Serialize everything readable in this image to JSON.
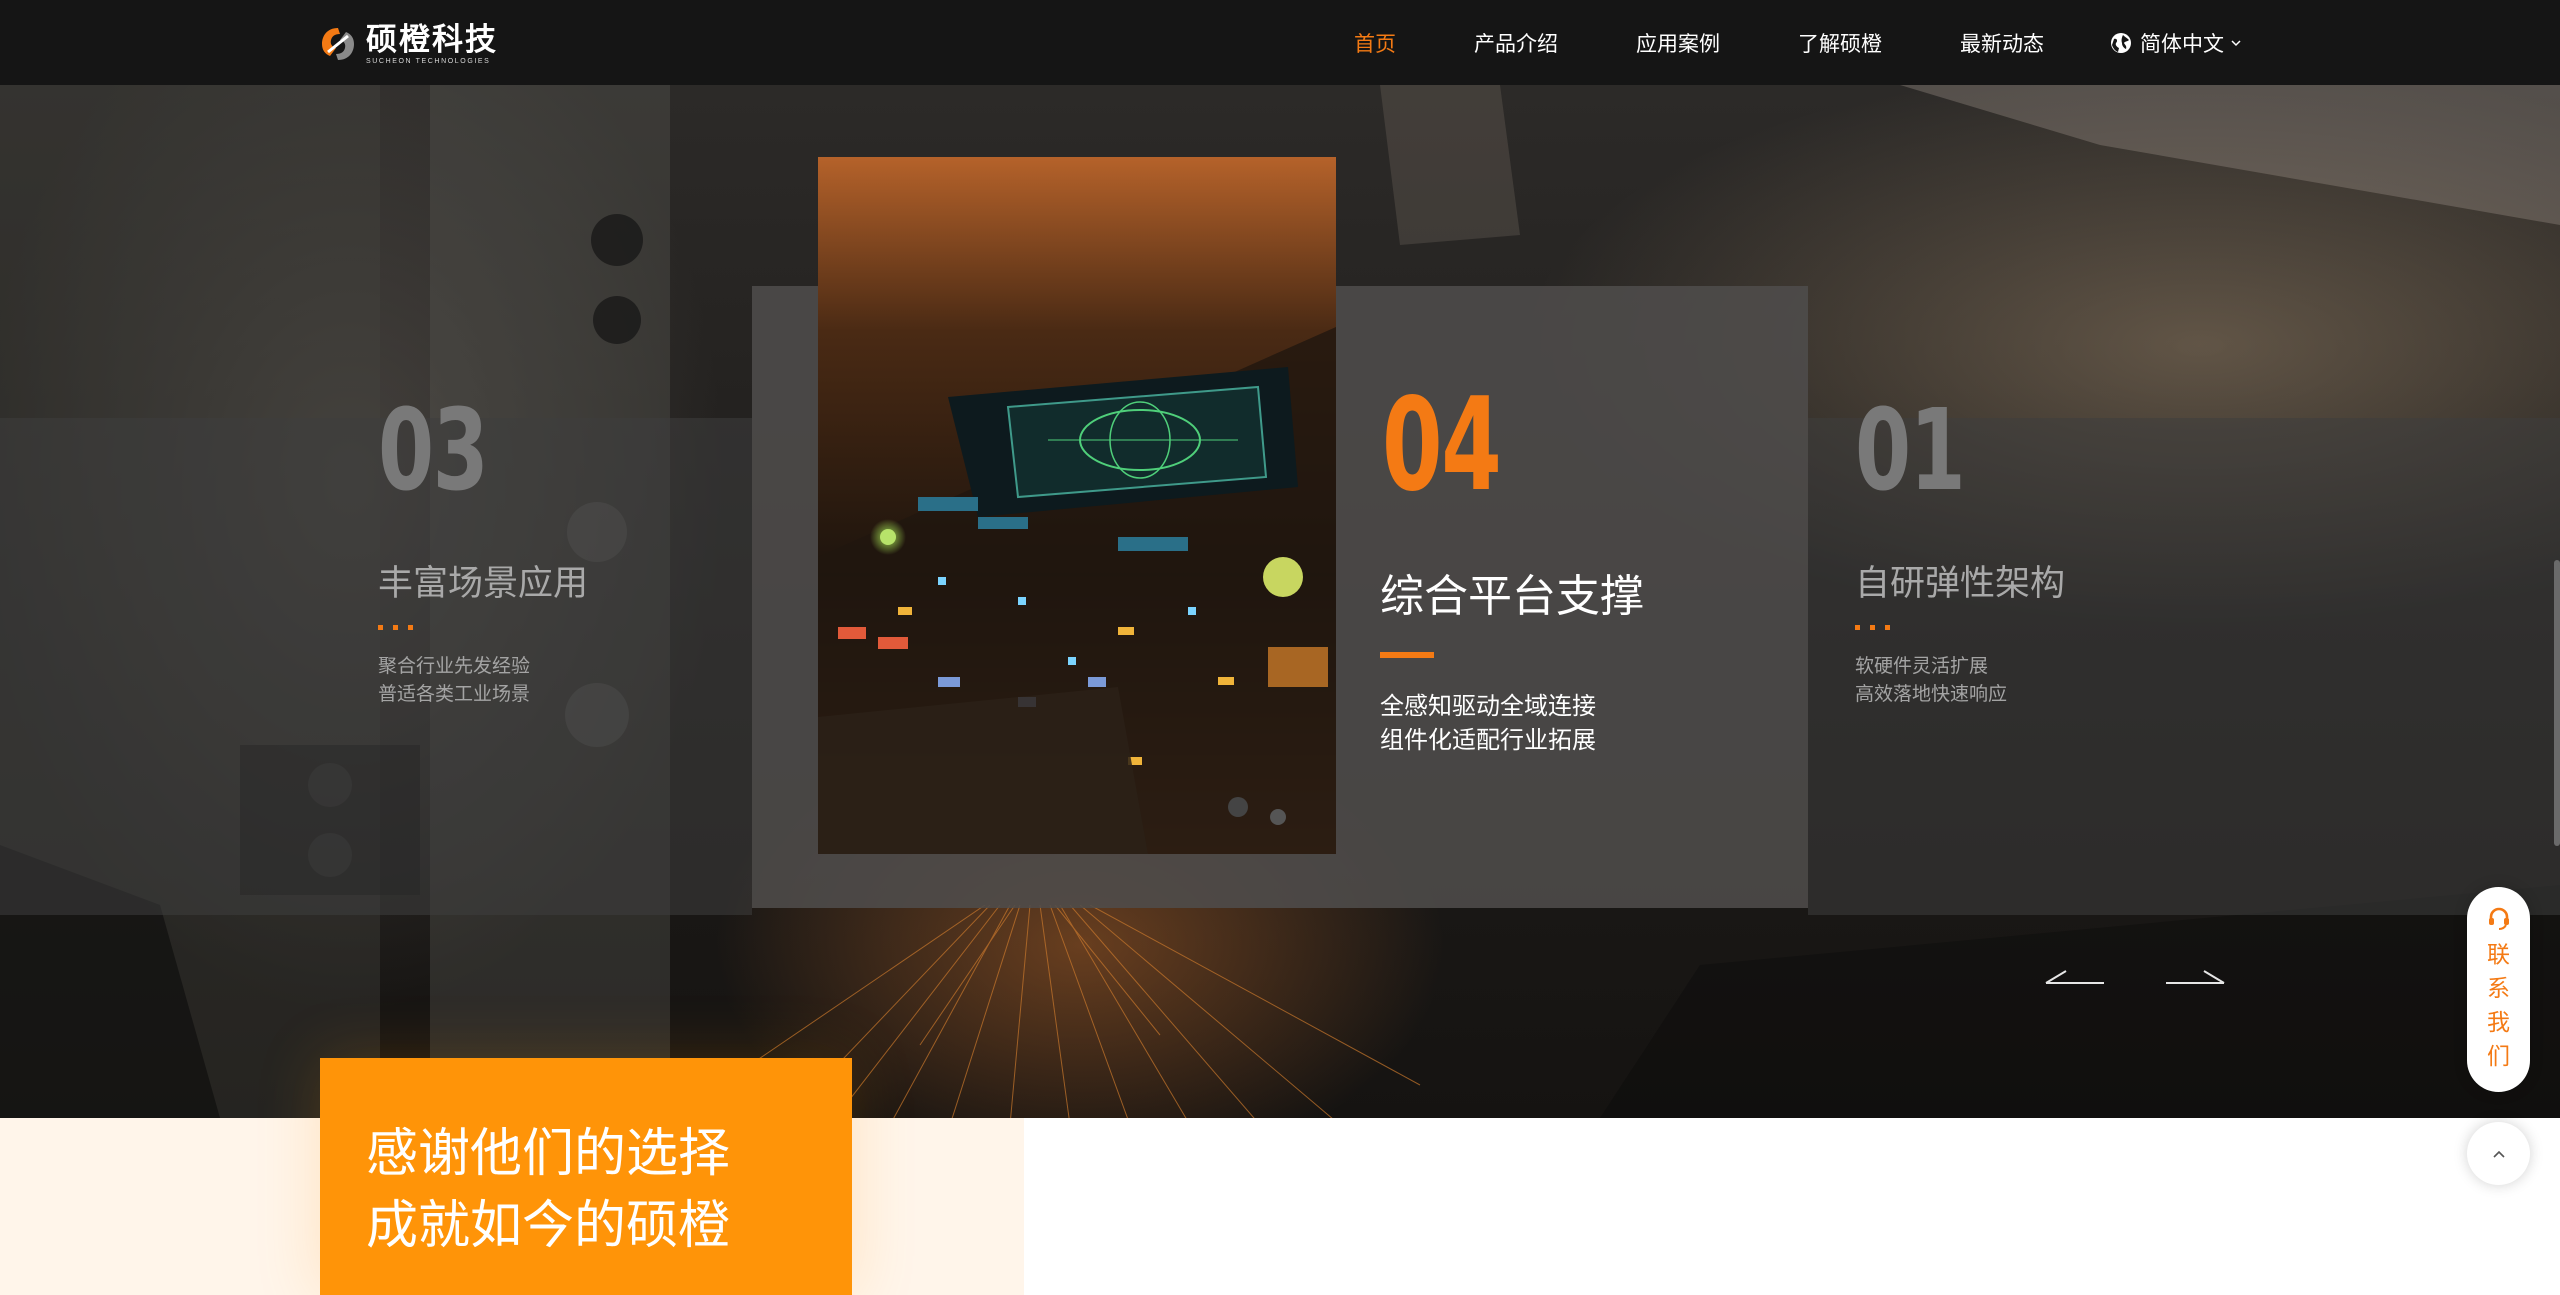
{
  "brand": {
    "name": "硕橙科技",
    "tagline": "SUCHEON TECHNOLOGIES"
  },
  "nav": {
    "items": [
      "首页",
      "产品介绍",
      "应用案例",
      "了解硕橙",
      "最新动态"
    ],
    "active_index": 0,
    "language": "简体中文"
  },
  "carousel": {
    "left": {
      "number": "03",
      "title": "丰富场景应用",
      "desc": [
        "聚合行业先发经验",
        "普适各类工业场景"
      ]
    },
    "center": {
      "number": "04",
      "title": "综合平台支撑",
      "desc": [
        "全感知驱动全域连接",
        "组件化适配行业拓展"
      ]
    },
    "right": {
      "number": "01",
      "title": "自研弹性架构",
      "desc": [
        "软硬件灵活扩展",
        "高效落地快速响应"
      ]
    }
  },
  "thanks": {
    "line1": "感谢他们的选择",
    "line2": "成就如今的硕橙"
  },
  "contact": {
    "chars": [
      "联",
      "系",
      "我",
      "们"
    ]
  },
  "colors": {
    "accent": "#f47a14",
    "header_bg": "#151515",
    "thanks_bg": "#ff9408"
  },
  "icons": {
    "logo": "sucheon-logo-icon",
    "language": "globe-icon",
    "language_caret": "chevron-down-icon",
    "prev": "arrow-left-icon",
    "next": "arrow-right-icon",
    "contact": "headset-icon",
    "back_to_top": "chevron-up-icon"
  }
}
